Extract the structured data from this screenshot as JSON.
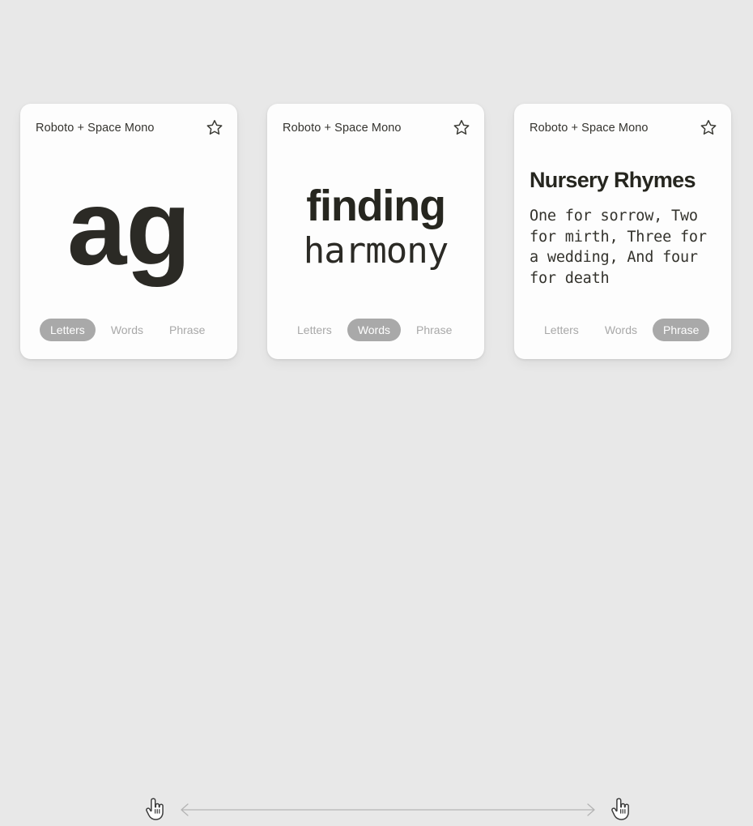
{
  "background_color": "#e8e8e8",
  "accent_color": "#a9a9a9",
  "text_color": "#2b2a25",
  "cards": [
    {
      "label": "Roboto + Space Mono",
      "star_icon": "star-outline-icon",
      "mode": "letters",
      "letters_sample": "ag",
      "tabs": [
        {
          "label": "Letters",
          "active": true
        },
        {
          "label": "Words",
          "active": false
        },
        {
          "label": "Phrase",
          "active": false
        }
      ]
    },
    {
      "label": "Roboto + Space Mono",
      "star_icon": "star-outline-icon",
      "mode": "words",
      "word_primary": "finding",
      "word_secondary": "harmony",
      "tabs": [
        {
          "label": "Letters",
          "active": false
        },
        {
          "label": "Words",
          "active": true
        },
        {
          "label": "Phrase",
          "active": false
        }
      ]
    },
    {
      "label": "Roboto + Space Mono",
      "star_icon": "star-outline-icon",
      "mode": "phrase",
      "phrase_title": "Nursery Rhymes",
      "phrase_body": "One for sorrow, Two for mirth, Three for a wedding, And four for death",
      "tabs": [
        {
          "label": "Letters",
          "active": false
        },
        {
          "label": "Words",
          "active": false
        },
        {
          "label": "Phrase",
          "active": true
        }
      ]
    }
  ],
  "slider": {
    "left_cursor_icon": "pointing-hand-cursor-icon",
    "right_cursor_icon": "pointing-hand-cursor-icon",
    "arrow_icon": "double-headed-horizontal-arrow-icon"
  }
}
